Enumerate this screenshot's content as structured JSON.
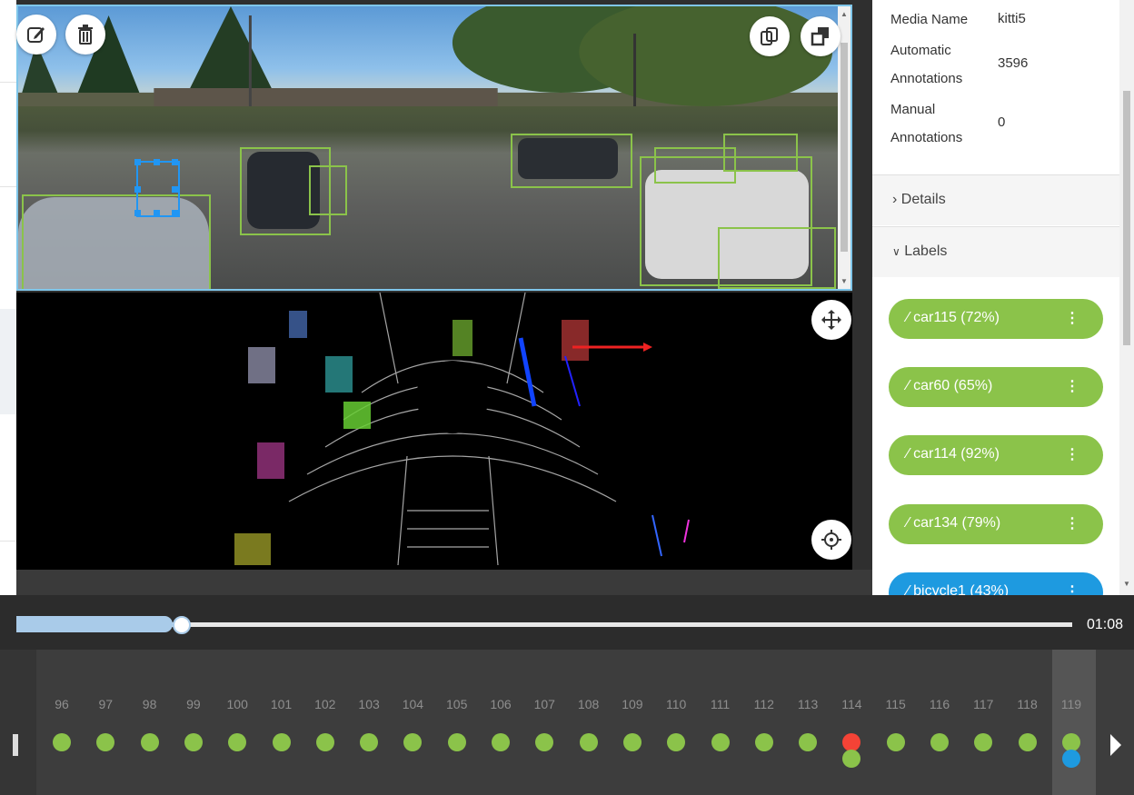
{
  "colors": {
    "annotation_green": "#8bc34a",
    "selected_blue": "#1e9ae0",
    "keyframe_red": "#f44336"
  },
  "camera": {
    "toolbar": {
      "edit_icon": "pencil-square-icon",
      "delete_icon": "trash-icon",
      "copy_icon": "copy-icon",
      "layers_icon": "layers-icon"
    }
  },
  "pointcloud": {
    "move_icon": "move-arrows-icon",
    "crosshair_icon": "crosshair-icon"
  },
  "sidebar": {
    "media_name_label": "Media Name",
    "media_name_value": "kitti5",
    "auto_label_1": "Automatic",
    "auto_label_2": "Annotations",
    "auto_value": "3596",
    "manual_label_1": "Manual",
    "manual_label_2": "Annotations",
    "manual_value": "0",
    "details_label": "Details",
    "labels_label": "Labels",
    "labels": [
      {
        "text": "car115 (72%)",
        "color": "#8bc34a"
      },
      {
        "text": "car60 (65%)",
        "color": "#8bc34a"
      },
      {
        "text": "car114 (92%)",
        "color": "#8bc34a"
      },
      {
        "text": "car134 (79%)",
        "color": "#8bc34a"
      },
      {
        "text": "bicycle1 (43%)",
        "color": "#1e9ae0"
      }
    ]
  },
  "player": {
    "progress": 0.148,
    "time": "01:08"
  },
  "timeline": {
    "frames": [
      "96",
      "97",
      "98",
      "99",
      "100",
      "101",
      "102",
      "103",
      "104",
      "105",
      "106",
      "107",
      "108",
      "109",
      "110",
      "111",
      "112",
      "113",
      "114",
      "115",
      "116",
      "117",
      "118",
      "119"
    ],
    "active_frame": "119",
    "keyframe": "114"
  }
}
